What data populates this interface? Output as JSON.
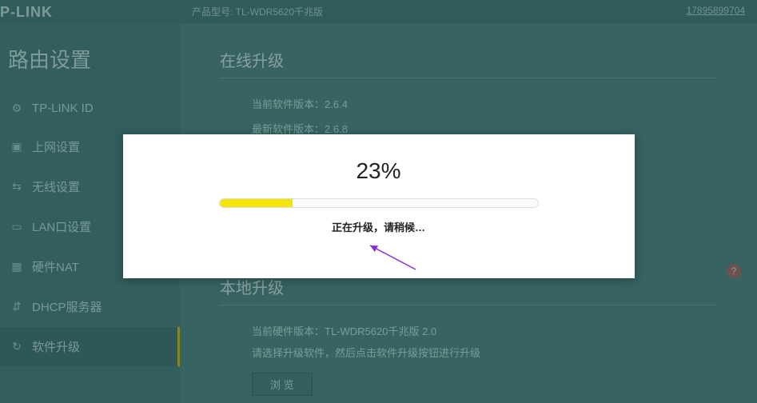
{
  "brand": "P-LINK",
  "header": {
    "model_label": "产品型号: TL-WDR5620千兆版",
    "phone": "17895899704"
  },
  "sidebar": {
    "title": "路由设置",
    "items": [
      {
        "label": "TP-LINK ID",
        "icon": "⚙"
      },
      {
        "label": "上网设置",
        "icon": "▣"
      },
      {
        "label": "无线设置",
        "icon": "⇆"
      },
      {
        "label": "LAN口设置",
        "icon": "▭"
      },
      {
        "label": "硬件NAT",
        "icon": "▦"
      },
      {
        "label": "DHCP服务器",
        "icon": "⇵"
      },
      {
        "label": "软件升级",
        "icon": "↻"
      }
    ]
  },
  "online": {
    "title": "在线升级",
    "current_label": "当前软件版本：",
    "current_value": "2.6.4",
    "latest_label": "最新软件版本：",
    "latest_value": "2.6.8"
  },
  "local": {
    "title": "本地升级",
    "hw_label": "当前硬件版本：",
    "hw_value": "TL-WDR5620千兆版 2.0",
    "hint": "请选择升级软件，然后点击软件升级按钮进行升级",
    "browse": "浏 览"
  },
  "help": "?",
  "modal": {
    "percent": "23%",
    "progress": 23,
    "message": "正在升级，请稍候…"
  }
}
